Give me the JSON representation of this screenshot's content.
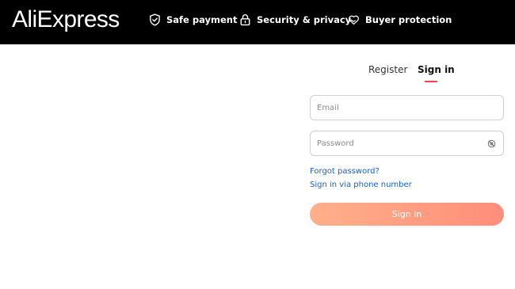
{
  "header": {
    "logo_text": "AliExpress",
    "badges": [
      {
        "label": "Safe payment",
        "icon": "shield-check-icon"
      },
      {
        "label": "Security & privacy",
        "icon": "lock-icon"
      },
      {
        "label": "Buyer protection",
        "icon": "heart-hand-icon"
      }
    ]
  },
  "tabs": [
    {
      "label": "Register",
      "active": false
    },
    {
      "label": "Sign in",
      "active": true
    }
  ],
  "form": {
    "email": {
      "placeholder": "Email",
      "value": ""
    },
    "password": {
      "placeholder": "Password",
      "value": "",
      "toggle_icon": "eye-off-icon"
    },
    "forgot_password_link": "Forgot password?",
    "phone_signin_link": "Sign in via phone number",
    "submit_label": "Sign in"
  },
  "colors": {
    "header_bg": "#000000",
    "tab_underline": "#ff4747",
    "link": "#1a62c5",
    "button_gradient_start": "#ffb08a",
    "button_gradient_end": "#ff8d7a"
  }
}
